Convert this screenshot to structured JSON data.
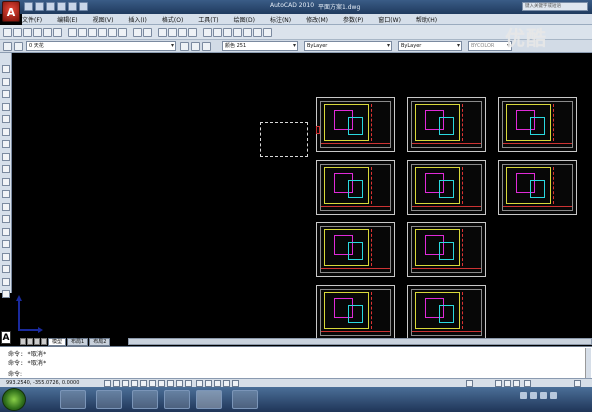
{
  "app": {
    "title": "AutoCAD 2010",
    "file": "平面方案1.dwg",
    "logo_letter": "A",
    "search_placeholder": "键入关键字或短语"
  },
  "menu": [
    "文件(F)",
    "编辑(E)",
    "视图(V)",
    "插入(I)",
    "格式(O)",
    "工具(T)",
    "绘图(D)",
    "标注(N)",
    "修改(M)",
    "参数(P)",
    "窗口(W)",
    "帮助(H)"
  ],
  "toolbar": {
    "layer_value": "0 天花",
    "color_value": "颜色 251",
    "linetype_value": "ByLayer",
    "lineweight_value": "ByLayer",
    "plotstyle_value": "BYCOLOR"
  },
  "watermark": "优酷",
  "sheets_count": 11,
  "tabs": [
    {
      "label": "模型",
      "active": true
    },
    {
      "label": "布局1",
      "active": false
    },
    {
      "label": "布局2",
      "active": false
    }
  ],
  "command": {
    "lines": [
      "命令: *取消*",
      "命令: *取消*"
    ],
    "prompt": "命令:"
  },
  "status": {
    "coords": "993.2540, -355.0726, 0.0000"
  },
  "colors": {
    "canvas": "#000000",
    "title_bar": "#2b4a72",
    "sheet_border": "#c8c8c8",
    "accent_red": "#c32a1f"
  }
}
